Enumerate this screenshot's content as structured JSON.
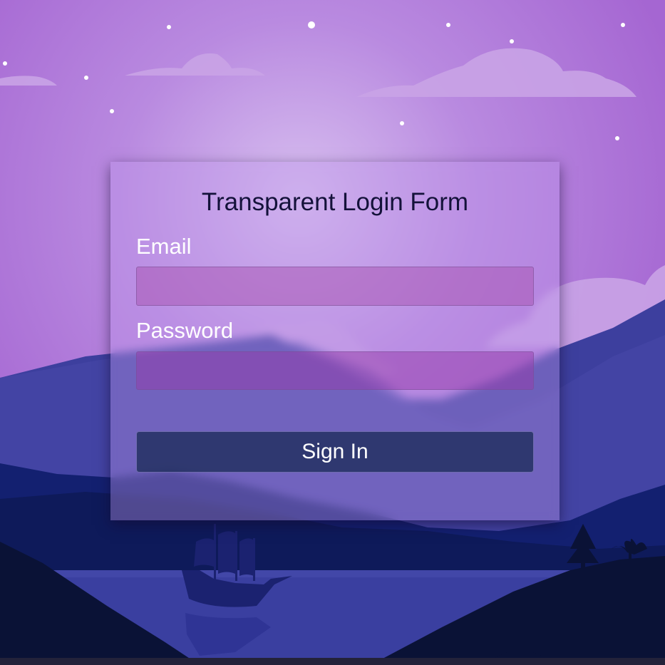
{
  "form": {
    "title": "Transparent Login Form",
    "email_label": "Email",
    "email_value": "",
    "password_label": "Password",
    "password_value": "",
    "signin_label": "Sign In"
  },
  "colors": {
    "sky_top": "#a86fd4",
    "sky_glow": "#c9a6e8",
    "mountain_back": "#3d3f9e",
    "mountain_front": "#0f1a58",
    "foreground_dark": "#0a1236",
    "water": "#3a3fa0",
    "button_bg": "#1c2d5a"
  },
  "background_icons": [
    "moon-glow",
    "stars",
    "clouds",
    "mountains",
    "sailing-ship-icon",
    "pine-tree-icon",
    "palm-tree-icon"
  ]
}
